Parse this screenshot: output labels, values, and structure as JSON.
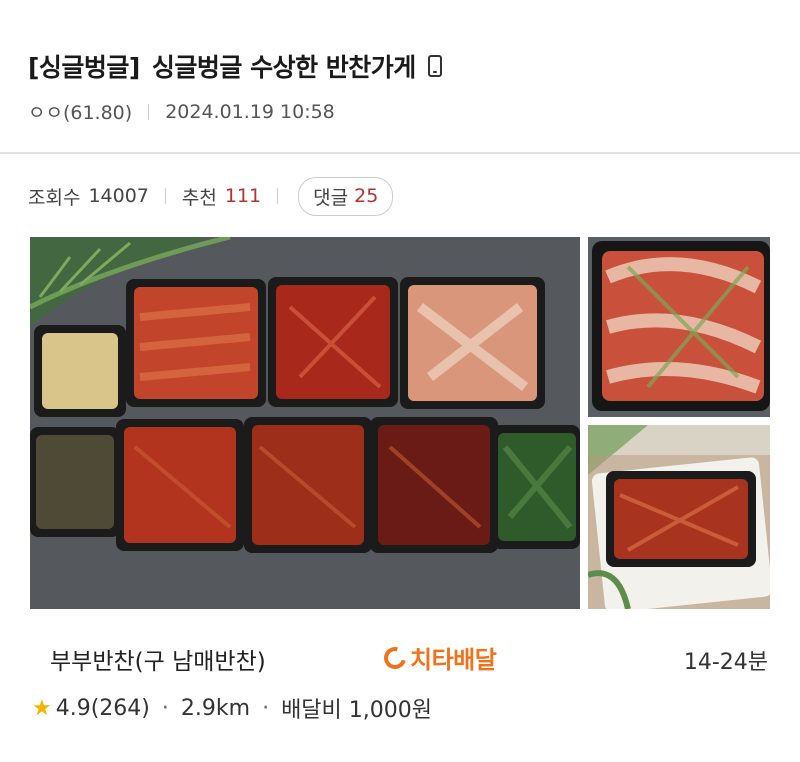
{
  "post": {
    "tag": "[싱글벙글]",
    "title": "싱글벙글 수상한 반찬가게",
    "author": "ㅇㅇ(61.80)",
    "datetime": "2024.01.19 10:58"
  },
  "stats": {
    "views_label": "조회수",
    "views": "14007",
    "recommend_label": "추천",
    "recommend": "111",
    "comments_label": "댓글",
    "comments": "25"
  },
  "shop": {
    "name": "부부반찬(구 남매반찬)",
    "badge": "치타배달",
    "delivery_time": "14-24분",
    "rating": "4.9(264)",
    "distance": "2.9km",
    "fee": "배달비 1,000원"
  },
  "colors": {
    "accent_red": "#b3322e",
    "cheetah_orange": "#f0731b",
    "star": "#f5b400"
  }
}
